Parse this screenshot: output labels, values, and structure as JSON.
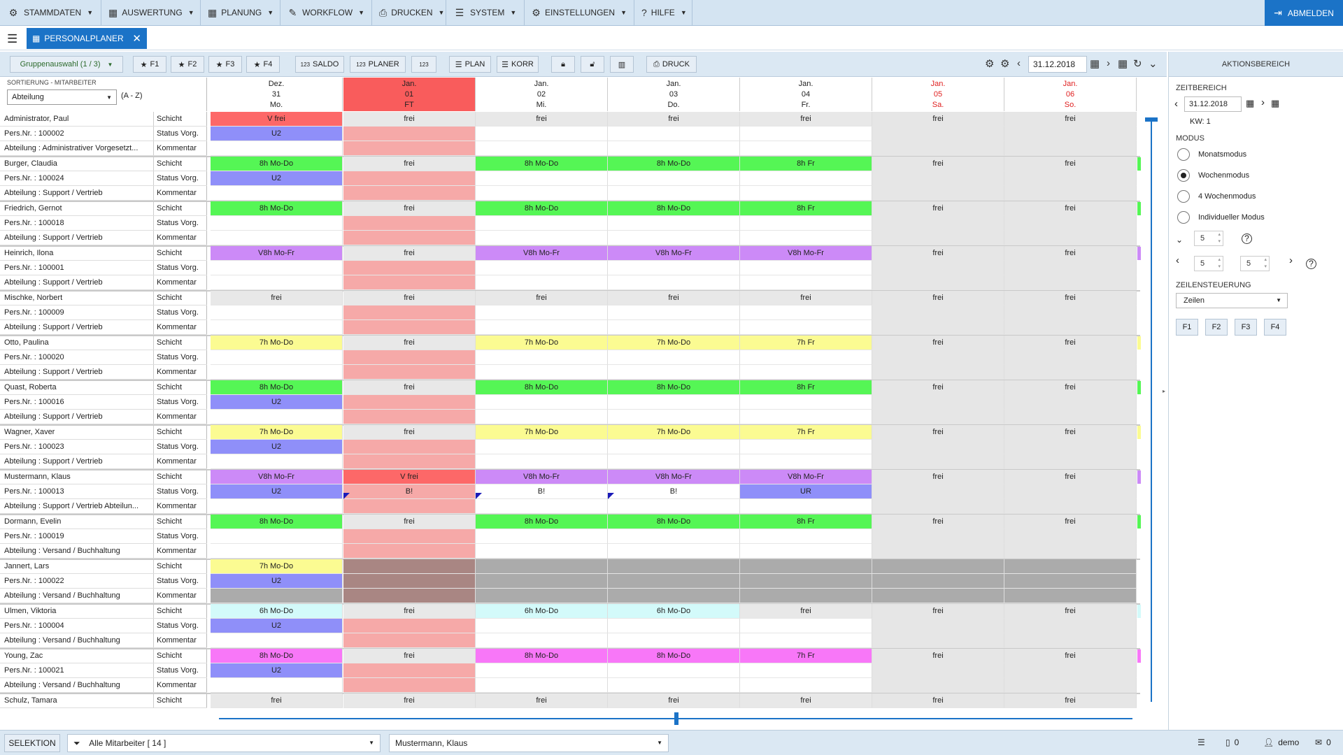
{
  "menu": [
    {
      "icon": "network-icon",
      "glyph": "⚙",
      "label": "STAMMDATEN",
      "w": 145
    },
    {
      "icon": "calendar-icon",
      "glyph": "▦",
      "label": "AUSWERTUNG",
      "w": 142
    },
    {
      "icon": "calendar-icon",
      "glyph": "▦",
      "label": "PLANUNG",
      "w": 114
    },
    {
      "icon": "pencil-icon",
      "glyph": "✎",
      "label": "WORKFLOW",
      "w": 131
    },
    {
      "icon": "printer-icon",
      "glyph": "⎙",
      "label": "DRUCKEN",
      "w": 106
    },
    {
      "icon": "server-icon",
      "glyph": "☰",
      "label": "SYSTEM",
      "w": 112
    },
    {
      "icon": "gear-icon",
      "glyph": "⚙",
      "label": "EINSTELLUNGEN",
      "w": 157
    },
    {
      "icon": "help-icon",
      "glyph": "?",
      "label": "HILFE",
      "w": 83
    }
  ],
  "logout_label": "ABMELDEN",
  "tab_label": "PERSONALPLANER",
  "toolbar": {
    "group": "Gruppenauswahl (1 / 3)",
    "f1": "F1",
    "f2": "F2",
    "f3": "F3",
    "f4": "F4",
    "saldo": "SALDO",
    "planer": "PLANER",
    "num": "123",
    "plan": "PLAN",
    "korr": "KORR",
    "druck": "DRUCK",
    "date": "31.12.2018"
  },
  "sort": {
    "label": "SORTIERUNG - MITARBEITER",
    "value": "Abteilung",
    "order": "(A - Z)"
  },
  "days": [
    {
      "month": "Dez.",
      "day": "31",
      "wd": "Mo.",
      "type": "normal"
    },
    {
      "month": "Jan.",
      "day": "01",
      "wd": "FT",
      "type": "holiday"
    },
    {
      "month": "Jan.",
      "day": "02",
      "wd": "Mi.",
      "type": "normal"
    },
    {
      "month": "Jan.",
      "day": "03",
      "wd": "Do.",
      "type": "normal"
    },
    {
      "month": "Jan.",
      "day": "04",
      "wd": "Fr.",
      "type": "normal"
    },
    {
      "month": "Jan.",
      "day": "05",
      "wd": "Sa.",
      "type": "weekend"
    },
    {
      "month": "Jan.",
      "day": "06",
      "wd": "So.",
      "type": "weekend"
    }
  ],
  "row_labels": {
    "schicht": "Schicht",
    "status": "Status Vorg.",
    "komm": "Kommentar"
  },
  "employees": [
    {
      "name": "Administrator, Paul",
      "pers": "Pers.Nr. : 100002",
      "dept": "Abteilung : Administrativer Vorgesetzt...",
      "stripe": "",
      "shifts": [
        [
          "V frei",
          "red"
        ],
        [
          "frei",
          "gs"
        ],
        [
          "frei",
          "gs"
        ],
        [
          "frei",
          "gs"
        ],
        [
          "frei",
          "gs"
        ],
        [
          "frei",
          "gw"
        ],
        [
          "frei",
          "gw"
        ]
      ],
      "status": [
        [
          "U2",
          "blue"
        ],
        [
          "",
          "gh"
        ],
        [
          "",
          ""
        ],
        [
          "",
          ""
        ],
        [
          "",
          ""
        ],
        [
          "",
          "gw"
        ],
        [
          "",
          "gw"
        ]
      ]
    },
    {
      "name": "Burger, Claudia",
      "pers": "Pers.Nr. : 100024",
      "dept": "Abteilung : Support / Vertrieb",
      "stripe": "#55f655",
      "shifts": [
        [
          "8h Mo-Do",
          "green"
        ],
        [
          "frei",
          "gs"
        ],
        [
          "8h Mo-Do",
          "green"
        ],
        [
          "8h Mo-Do",
          "green"
        ],
        [
          "8h Fr",
          "green"
        ],
        [
          "frei",
          "gw"
        ],
        [
          "frei",
          "gw"
        ]
      ],
      "status": [
        [
          "U2",
          "blue"
        ],
        [
          "",
          "gh"
        ],
        [
          "",
          ""
        ],
        [
          "",
          ""
        ],
        [
          "",
          ""
        ],
        [
          "",
          "gw"
        ],
        [
          "",
          "gw"
        ]
      ]
    },
    {
      "name": "Friedrich, Gernot",
      "pers": "Pers.Nr. : 100018",
      "dept": "Abteilung : Support / Vertrieb",
      "stripe": "#55f655",
      "shifts": [
        [
          "8h Mo-Do",
          "green"
        ],
        [
          "frei",
          "gs"
        ],
        [
          "8h Mo-Do",
          "green"
        ],
        [
          "8h Mo-Do",
          "green"
        ],
        [
          "8h Fr",
          "green"
        ],
        [
          "frei",
          "gw"
        ],
        [
          "frei",
          "gw"
        ]
      ],
      "status": [
        [
          "",
          ""
        ],
        [
          "",
          "gh"
        ],
        [
          "",
          ""
        ],
        [
          "",
          ""
        ],
        [
          "",
          ""
        ],
        [
          "",
          "gw"
        ],
        [
          "",
          "gw"
        ]
      ]
    },
    {
      "name": "Heinrich, Ilona",
      "pers": "Pers.Nr. : 100001",
      "dept": "Abteilung : Support / Vertrieb",
      "stripe": "#cc8af7",
      "shifts": [
        [
          "V8h Mo-Fr",
          "purple"
        ],
        [
          "frei",
          "gs"
        ],
        [
          "V8h Mo-Fr",
          "purple"
        ],
        [
          "V8h Mo-Fr",
          "purple"
        ],
        [
          "V8h Mo-Fr",
          "purple"
        ],
        [
          "frei",
          "gw"
        ],
        [
          "frei",
          "gw"
        ]
      ],
      "status": [
        [
          "",
          ""
        ],
        [
          "",
          "gh"
        ],
        [
          "",
          ""
        ],
        [
          "",
          ""
        ],
        [
          "",
          ""
        ],
        [
          "",
          "gw"
        ],
        [
          "",
          "gw"
        ]
      ]
    },
    {
      "name": "Mischke, Norbert",
      "pers": "Pers.Nr. : 100009",
      "dept": "Abteilung : Support / Vertrieb",
      "stripe": "",
      "shifts": [
        [
          "frei",
          "gs"
        ],
        [
          "frei",
          "gs"
        ],
        [
          "frei",
          "gs"
        ],
        [
          "frei",
          "gs"
        ],
        [
          "frei",
          "gs"
        ],
        [
          "frei",
          "gw"
        ],
        [
          "frei",
          "gw"
        ]
      ],
      "status": [
        [
          "",
          ""
        ],
        [
          "",
          "gh"
        ],
        [
          "",
          ""
        ],
        [
          "",
          ""
        ],
        [
          "",
          ""
        ],
        [
          "",
          "gw"
        ],
        [
          "",
          "gw"
        ]
      ]
    },
    {
      "name": "Otto, Paulina",
      "pers": "Pers.Nr. : 100020",
      "dept": "Abteilung : Support / Vertrieb",
      "stripe": "#fbfb92",
      "shifts": [
        [
          "7h Mo-Do",
          "yellow"
        ],
        [
          "frei",
          "gs"
        ],
        [
          "7h Mo-Do",
          "yellow"
        ],
        [
          "7h Mo-Do",
          "yellow"
        ],
        [
          "7h Fr",
          "yellow"
        ],
        [
          "frei",
          "gw"
        ],
        [
          "frei",
          "gw"
        ]
      ],
      "status": [
        [
          "",
          ""
        ],
        [
          "",
          "gh"
        ],
        [
          "",
          ""
        ],
        [
          "",
          ""
        ],
        [
          "",
          ""
        ],
        [
          "",
          "gw"
        ],
        [
          "",
          "gw"
        ]
      ]
    },
    {
      "name": "Quast, Roberta",
      "pers": "Pers.Nr. : 100016",
      "dept": "Abteilung : Support / Vertrieb",
      "stripe": "#55f655",
      "shifts": [
        [
          "8h Mo-Do",
          "green"
        ],
        [
          "frei",
          "gs"
        ],
        [
          "8h Mo-Do",
          "green"
        ],
        [
          "8h Mo-Do",
          "green"
        ],
        [
          "8h Fr",
          "green"
        ],
        [
          "frei",
          "gw"
        ],
        [
          "frei",
          "gw"
        ]
      ],
      "status": [
        [
          "U2",
          "blue"
        ],
        [
          "",
          "gh"
        ],
        [
          "",
          ""
        ],
        [
          "",
          ""
        ],
        [
          "",
          ""
        ],
        [
          "",
          "gw"
        ],
        [
          "",
          "gw"
        ]
      ]
    },
    {
      "name": "Wagner, Xaver",
      "pers": "Pers.Nr. : 100023",
      "dept": "Abteilung : Support / Vertrieb",
      "stripe": "#fbfb92",
      "shifts": [
        [
          "7h Mo-Do",
          "yellow"
        ],
        [
          "frei",
          "gs"
        ],
        [
          "7h Mo-Do",
          "yellow"
        ],
        [
          "7h Mo-Do",
          "yellow"
        ],
        [
          "7h Fr",
          "yellow"
        ],
        [
          "frei",
          "gw"
        ],
        [
          "frei",
          "gw"
        ]
      ],
      "status": [
        [
          "U2",
          "blue"
        ],
        [
          "",
          "gh"
        ],
        [
          "",
          ""
        ],
        [
          "",
          ""
        ],
        [
          "",
          ""
        ],
        [
          "",
          "gw"
        ],
        [
          "",
          "gw"
        ]
      ]
    },
    {
      "name": "Mustermann, Klaus",
      "pers": "Pers.Nr. : 100013",
      "dept": "Abteilung : Support / Vertrieb Abteilun...",
      "stripe": "#cc8af7",
      "shifts": [
        [
          "V8h Mo-Fr",
          "purple"
        ],
        [
          "V frei",
          "red"
        ],
        [
          "V8h Mo-Fr",
          "purple"
        ],
        [
          "V8h Mo-Fr",
          "purple"
        ],
        [
          "V8h Mo-Fr",
          "purple"
        ],
        [
          "frei",
          "gw"
        ],
        [
          "frei",
          "gw"
        ]
      ],
      "status": [
        [
          "U2",
          "blue"
        ],
        [
          "B!",
          "holsel"
        ],
        [
          "B!",
          ""
        ],
        [
          "B!",
          ""
        ],
        [
          "UR",
          "blue"
        ],
        [
          "",
          "gw"
        ],
        [
          "",
          "gw"
        ]
      ]
    },
    {
      "name": "Dormann, Evelin",
      "pers": "Pers.Nr. : 100019",
      "dept": "Abteilung : Versand / Buchhaltung",
      "stripe": "#55f655",
      "shifts": [
        [
          "8h Mo-Do",
          "green"
        ],
        [
          "frei",
          "gs"
        ],
        [
          "8h Mo-Do",
          "green"
        ],
        [
          "8h Mo-Do",
          "green"
        ],
        [
          "8h Fr",
          "green"
        ],
        [
          "frei",
          "gw"
        ],
        [
          "frei",
          "gw"
        ]
      ],
      "status": [
        [
          "",
          ""
        ],
        [
          "",
          "gh"
        ],
        [
          "",
          ""
        ],
        [
          "",
          ""
        ],
        [
          "",
          ""
        ],
        [
          "",
          "gw"
        ],
        [
          "",
          "gw"
        ]
      ]
    },
    {
      "name": "Jannert, Lars",
      "pers": "Pers.Nr. : 100022",
      "dept": "Abteilung : Versand / Buchhaltung",
      "stripe": "",
      "shifts": [
        [
          "7h Mo-Do",
          "yellow"
        ],
        [
          "",
          "gdh"
        ],
        [
          "",
          "gd"
        ],
        [
          "",
          "gd"
        ],
        [
          "",
          "gd"
        ],
        [
          "",
          "gd"
        ],
        [
          "",
          "gd"
        ]
      ],
      "status": [
        [
          "U2",
          "blue"
        ],
        [
          "",
          "gdh"
        ],
        [
          "",
          "gd"
        ],
        [
          "",
          "gd"
        ],
        [
          "",
          "gd"
        ],
        [
          "",
          "gd"
        ],
        [
          "",
          "gd"
        ]
      ],
      "dark": true
    },
    {
      "name": "Ulmen, Viktoria",
      "pers": "Pers.Nr. : 100004",
      "dept": "Abteilung : Versand / Buchhaltung",
      "stripe": "#d3fafa",
      "shifts": [
        [
          "6h Mo-Do",
          "cyan"
        ],
        [
          "frei",
          "gs"
        ],
        [
          "6h Mo-Do",
          "cyan"
        ],
        [
          "6h Mo-Do",
          "cyan"
        ],
        [
          "frei",
          "gs"
        ],
        [
          "frei",
          "gw"
        ],
        [
          "frei",
          "gw"
        ]
      ],
      "status": [
        [
          "U2",
          "blue"
        ],
        [
          "",
          "gh"
        ],
        [
          "",
          ""
        ],
        [
          "",
          ""
        ],
        [
          "",
          ""
        ],
        [
          "",
          "gw"
        ],
        [
          "",
          "gw"
        ]
      ]
    },
    {
      "name": "Young, Zac",
      "pers": "Pers.Nr. : 100021",
      "dept": "Abteilung : Versand / Buchhaltung",
      "stripe": "#f877f8",
      "shifts": [
        [
          "8h Mo-Do",
          "magenta"
        ],
        [
          "frei",
          "gs"
        ],
        [
          "8h Mo-Do",
          "magenta"
        ],
        [
          "8h Mo-Do",
          "magenta"
        ],
        [
          "7h Fr",
          "magenta"
        ],
        [
          "frei",
          "gw"
        ],
        [
          "frei",
          "gw"
        ]
      ],
      "status": [
        [
          "U2",
          "blue"
        ],
        [
          "",
          "gh"
        ],
        [
          "",
          ""
        ],
        [
          "",
          ""
        ],
        [
          "",
          ""
        ],
        [
          "",
          "gw"
        ],
        [
          "",
          "gw"
        ]
      ]
    },
    {
      "name": "Schulz, Tamara",
      "pers": "",
      "dept": "",
      "stripe": "",
      "shifts": [
        [
          "frei",
          "gs"
        ],
        [
          "frei",
          "gs"
        ],
        [
          "frei",
          "gs"
        ],
        [
          "frei",
          "gs"
        ],
        [
          "frei",
          "gs"
        ],
        [
          "frei",
          "gw"
        ],
        [
          "frei",
          "gw"
        ]
      ],
      "status": [],
      "partial": true
    }
  ],
  "panel": {
    "title": "AKTIONSBEREICH",
    "zeitbereich": "ZEITBEREICH",
    "date": "31.12.2018",
    "kw": "KW: 1",
    "modus": "MODUS",
    "modes": [
      "Monatsmodus",
      "Wochenmodus",
      "4 Wochenmodus",
      "Individueller Modus"
    ],
    "selected_mode": 1,
    "spin1": "5",
    "spin2": "5",
    "spin3": "5",
    "zeilen_label": "ZEILENSTEUERUNG",
    "zeilen_value": "Zeilen",
    "fkeys": [
      "F1",
      "F2",
      "F3",
      "F4"
    ]
  },
  "bottom": {
    "selektion": "SELEKTION",
    "filter": "Alle Mitarbeiter  [ 14 ]",
    "employee": "Mustermann, Klaus",
    "pdf_count": "0",
    "user": "demo",
    "mail_count": "0"
  }
}
